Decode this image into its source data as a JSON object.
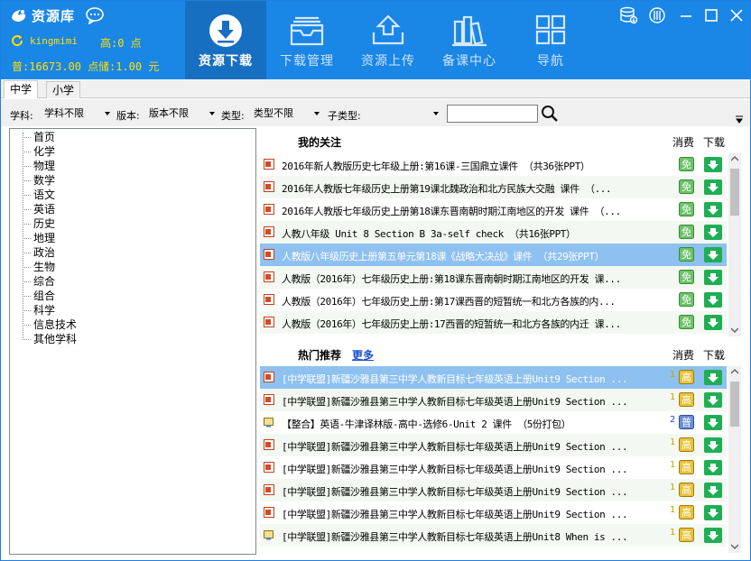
{
  "header": {
    "app_title": "资源库",
    "username": "kingmimi",
    "high_points": "高:0 点",
    "normal_points": "普:16673.00 点",
    "stored_points": "储:1.00 元",
    "nav": [
      {
        "label": "资源下载",
        "icon": "download-icon",
        "active": true
      },
      {
        "label": "下载管理",
        "icon": "inbox-icon",
        "active": false
      },
      {
        "label": "资源上传",
        "icon": "upload-icon",
        "active": false
      },
      {
        "label": "备课中心",
        "icon": "books-icon",
        "active": false
      },
      {
        "label": "导航",
        "icon": "grid-icon",
        "active": false
      }
    ],
    "accent": "#1a86e6"
  },
  "level_tabs": [
    "中学",
    "小学"
  ],
  "filters": {
    "subject_label": "学科:",
    "subject_value": "学科不限",
    "version_label": "版本:",
    "version_value": "版本不限",
    "type_label": "类型:",
    "type_value": "类型不限",
    "subtype_label": "子类型:",
    "subtype_value": "",
    "search_value": ""
  },
  "subject_tree": [
    "首页",
    "化学",
    "物理",
    "数学",
    "语文",
    "英语",
    "历史",
    "地理",
    "政治",
    "生物",
    "综合",
    "组合",
    "科学",
    "信息技术",
    "其他学科"
  ],
  "follow_panel": {
    "title": "我的关注",
    "col_fee": "消费",
    "col_download": "下载",
    "rows": [
      {
        "title": "2016年新人教版历史七年级上册:第16课-三国鼎立课件 （共36张PPT）",
        "badge": "免"
      },
      {
        "title": "2016年人教版七年级历史上册第19课北魏政治和北方民族大交融  课件 （...",
        "badge": "免"
      },
      {
        "title": "2016年人教版七年级历史上册第18课东晋南朝时期江南地区的开发 课件 （...",
        "badge": "免"
      },
      {
        "title": "人教八年级 Unit 8 Section B 3a-self check （共16张PPT）",
        "badge": "免"
      },
      {
        "title": "人教版八年级历史上册第五单元第18课《战略大决战》课件 （共29张PPT）",
        "badge": "免",
        "selected": true
      },
      {
        "title": "人教版（2016年）七年级历史上册:第18课东晋南朝时期江南地区的开发 课...",
        "badge": "免"
      },
      {
        "title": "人教版（2016年）七年级历史上册:第17课西晋的短暂统一和北方各族的内...",
        "badge": "免"
      },
      {
        "title": "人教版（2016年）七年级历史上册:17西晋的短暂统一和北方各族的内迁 课...",
        "badge": "免"
      }
    ]
  },
  "hot_panel": {
    "title": "热门推荐",
    "more_label": "更多",
    "col_fee": "消费",
    "col_download": "下载",
    "rows": [
      {
        "title": "[中学联盟]新疆沙雅县第三中学人教新目标七年级英语上册Unit9 Section ...",
        "points": "1",
        "badge": "高",
        "selected": true
      },
      {
        "title": "[中学联盟]新疆沙雅县第三中学人教新目标七年级英语上册Unit9 Section ...",
        "points": "1",
        "badge": "高"
      },
      {
        "title": "【整合】英语-牛津译林版-高中-选修6-Unit 2 课件 （5份打包）",
        "points": "2",
        "badge": "普",
        "file": "package"
      },
      {
        "title": "[中学联盟]新疆沙雅县第三中学人教新目标七年级英语上册Unit9 Section ...",
        "points": "1",
        "badge": "高"
      },
      {
        "title": "[中学联盟]新疆沙雅县第三中学人教新目标七年级英语上册Unit9 Section ...",
        "points": "1",
        "badge": "高"
      },
      {
        "title": "[中学联盟]新疆沙雅县第三中学人教新目标七年级英语上册Unit9 Section ...",
        "points": "1",
        "badge": "高"
      },
      {
        "title": "[中学联盟]新疆沙雅县第三中学人教新目标七年级英语上册Unit9 Section ...",
        "points": "1",
        "badge": "高"
      },
      {
        "title": "[中学联盟]新疆沙雅县第三中学人教新目标七年级英语上册Unit8 When is ...",
        "points": "1",
        "badge": "高",
        "file": "package"
      }
    ]
  }
}
